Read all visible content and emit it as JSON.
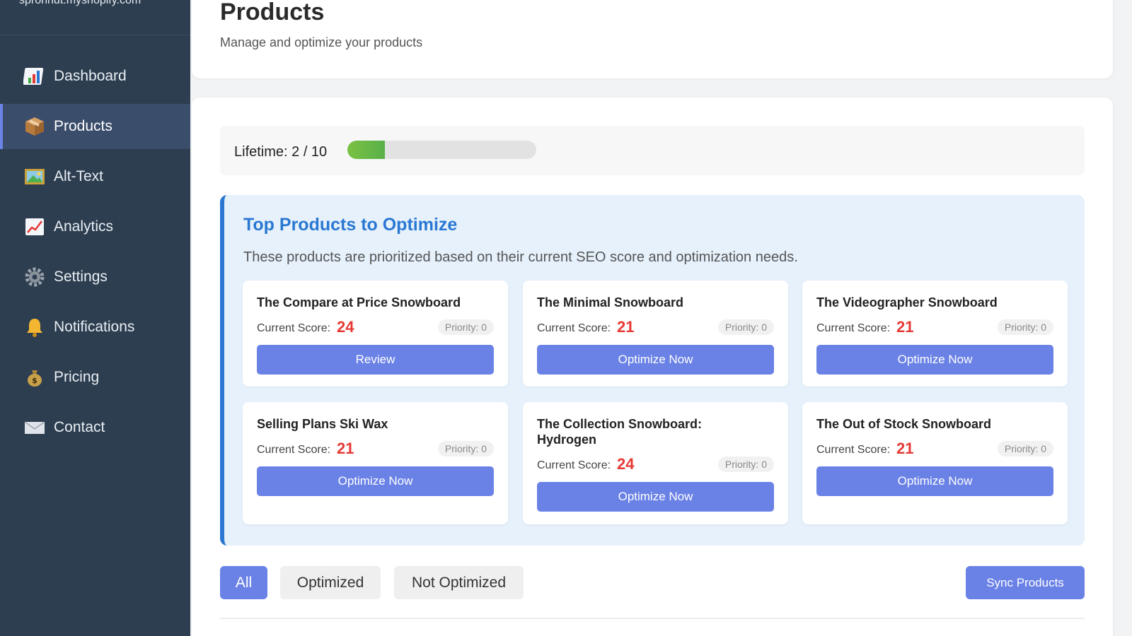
{
  "sidebar": {
    "store_name": "spronhut.myshopify.com",
    "items": [
      {
        "label": "Dashboard",
        "icon": "bar-chart-icon",
        "active": false
      },
      {
        "label": "Products",
        "icon": "package-icon",
        "active": true
      },
      {
        "label": "Alt-Text",
        "icon": "picture-icon",
        "active": false
      },
      {
        "label": "Analytics",
        "icon": "line-chart-icon",
        "active": false
      },
      {
        "label": "Settings",
        "icon": "gear-icon",
        "active": false
      },
      {
        "label": "Notifications",
        "icon": "bell-icon",
        "active": false
      },
      {
        "label": "Pricing",
        "icon": "money-bag-icon",
        "active": false
      },
      {
        "label": "Contact",
        "icon": "envelope-icon",
        "active": false
      }
    ]
  },
  "header": {
    "title": "Products",
    "subtitle": "Manage and optimize your products"
  },
  "lifetime": {
    "label": "Lifetime: 2 / 10",
    "used": 2,
    "total": 10
  },
  "top_products": {
    "title": "Top Products to Optimize",
    "description": "These products are prioritized based on their current SEO score and optimization needs.",
    "score_label": "Current Score:",
    "items": [
      {
        "name": "The Compare at Price Snowboard",
        "score": "24",
        "priority": "Priority: 0",
        "action": "Review"
      },
      {
        "name": "The Minimal Snowboard",
        "score": "21",
        "priority": "Priority: 0",
        "action": "Optimize Now"
      },
      {
        "name": "The Videographer Snowboard",
        "score": "21",
        "priority": "Priority: 0",
        "action": "Optimize Now"
      },
      {
        "name": "Selling Plans Ski Wax",
        "score": "21",
        "priority": "Priority: 0",
        "action": "Optimize Now"
      },
      {
        "name": "The Collection Snowboard: Hydrogen",
        "score": "24",
        "priority": "Priority: 0",
        "action": "Optimize Now"
      },
      {
        "name": "The Out of Stock Snowboard",
        "score": "21",
        "priority": "Priority: 0",
        "action": "Optimize Now"
      }
    ]
  },
  "filters": {
    "all": "All",
    "optimized": "Optimized",
    "not_optimized": "Not Optimized",
    "selected": "All"
  },
  "sync_label": "Sync Products",
  "colors": {
    "sidebar_bg": "#2d3e50",
    "accent": "#6a82e6",
    "heading_blue": "#2a78d2",
    "score_red": "#e53935"
  }
}
